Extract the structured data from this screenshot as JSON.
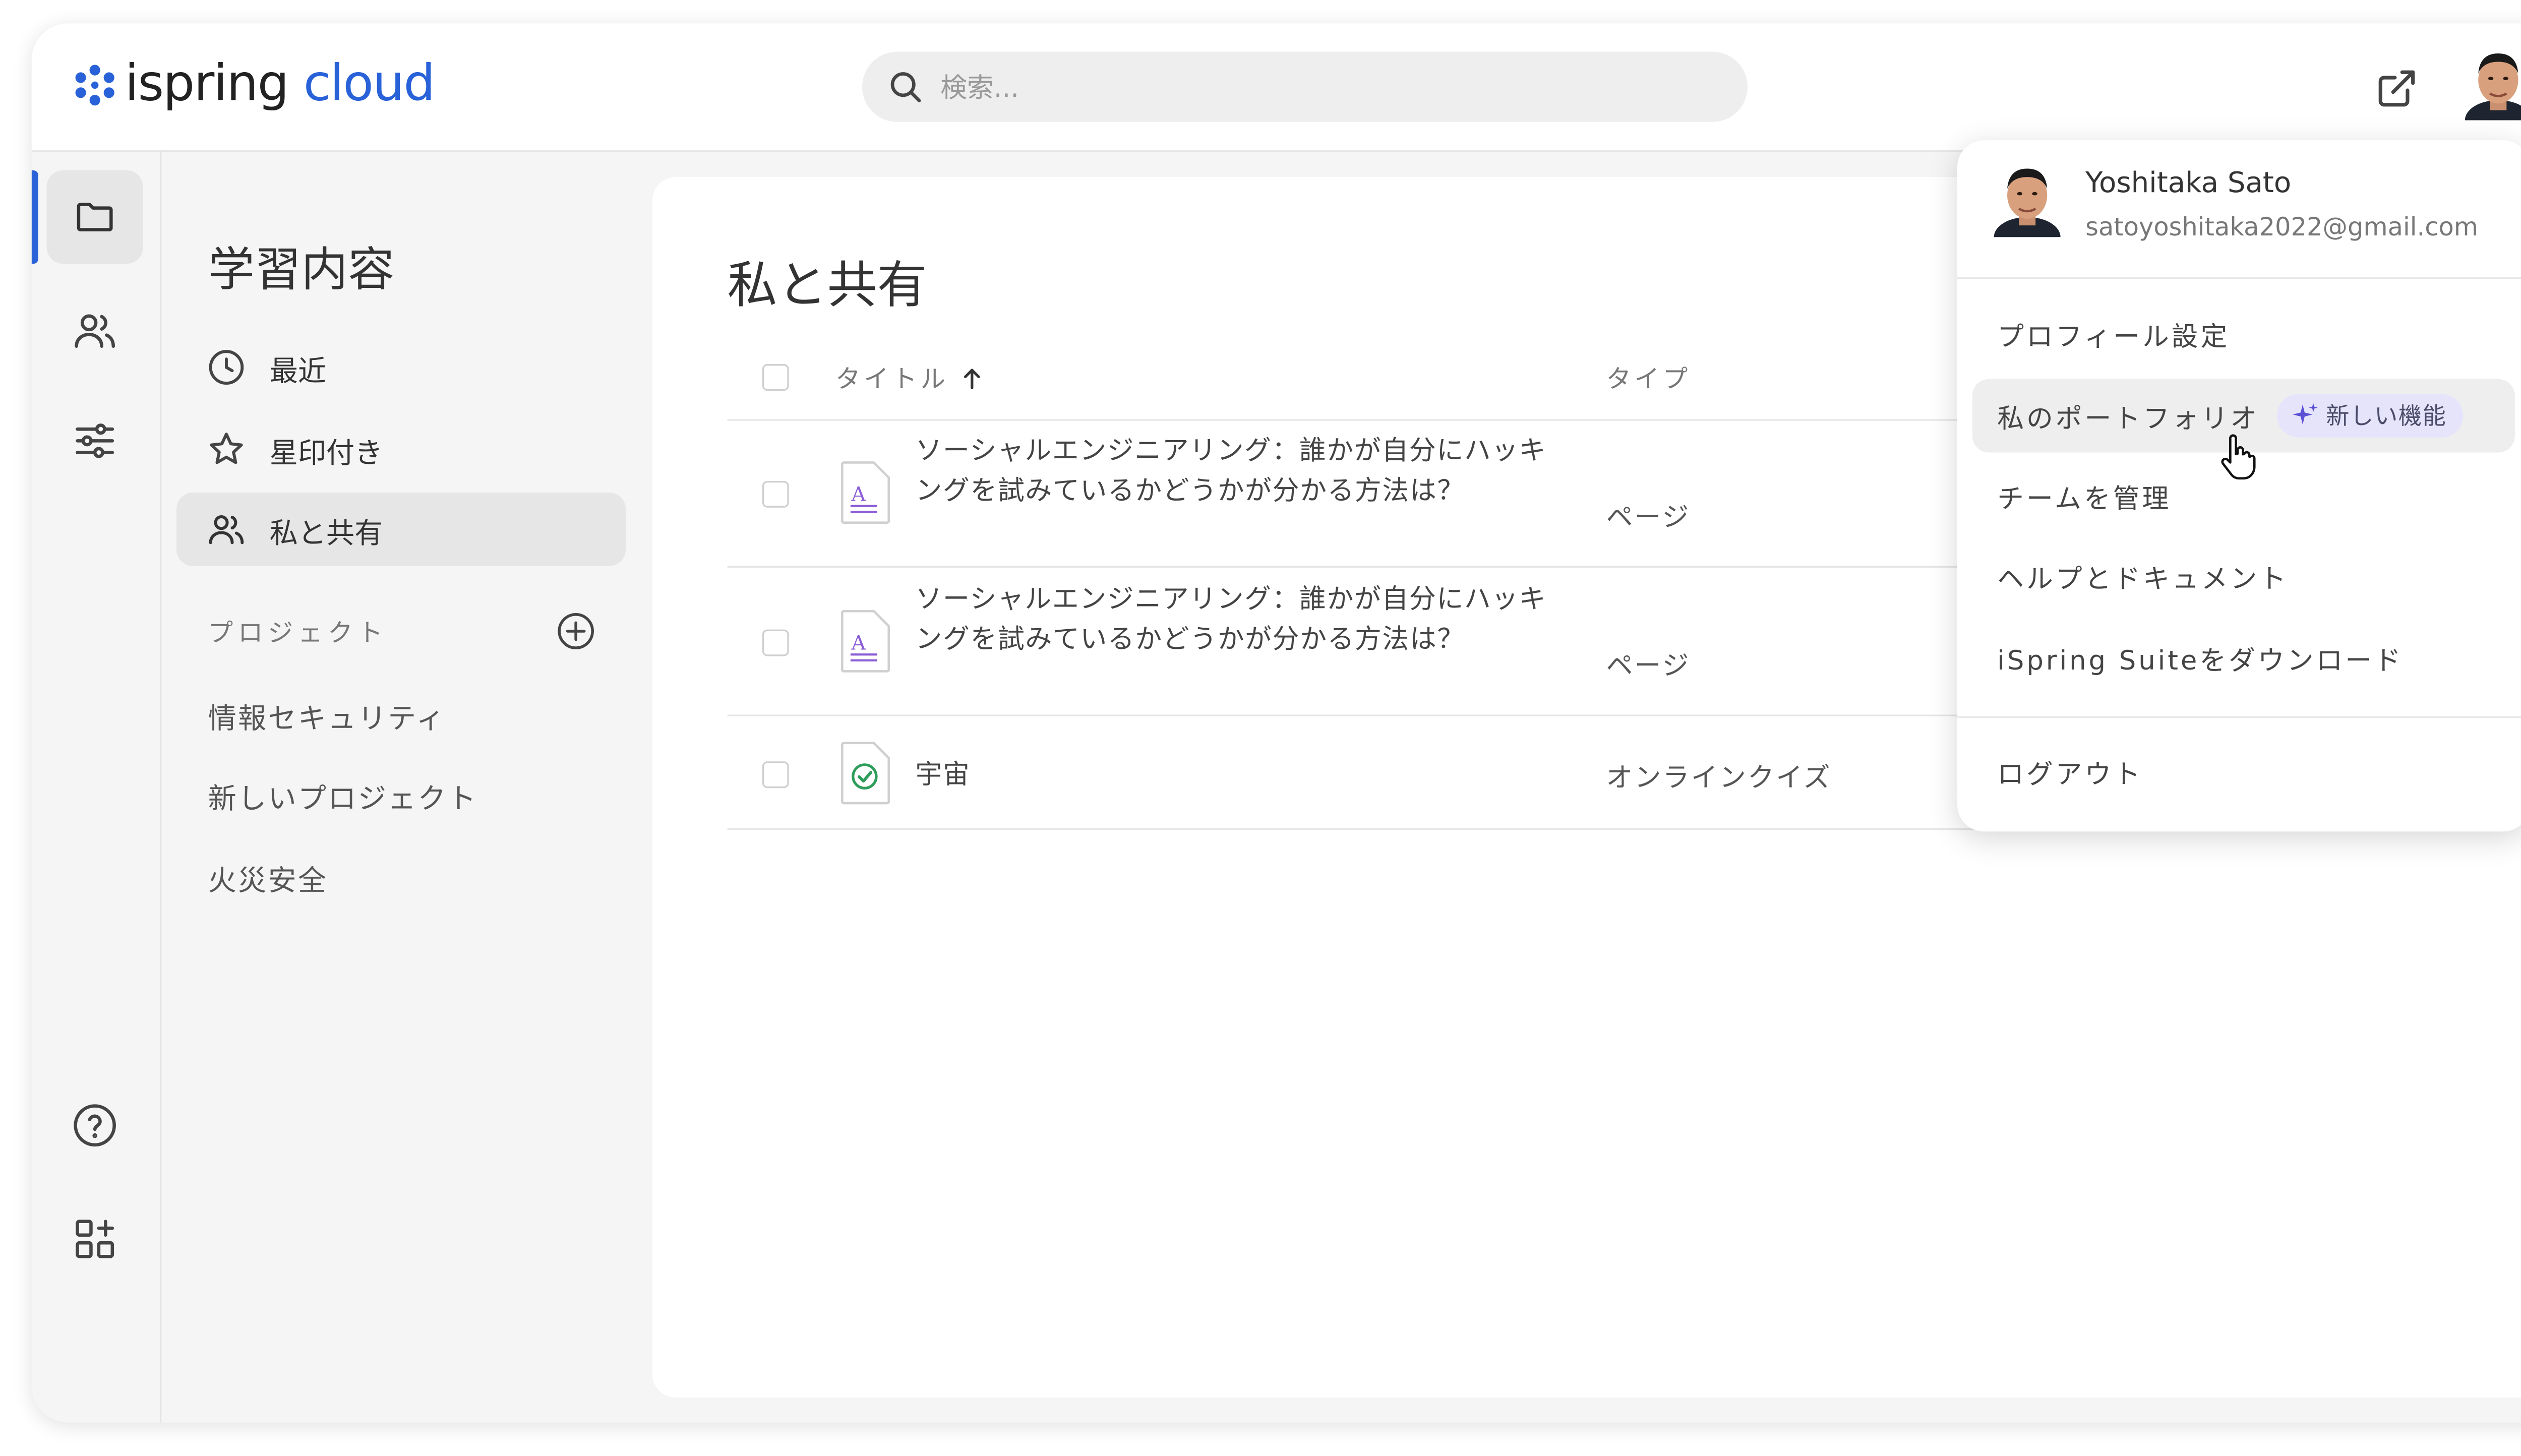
{
  "app": {
    "logo_word1": "ispring",
    "logo_word2": "cloud"
  },
  "search": {
    "placeholder": "検索..."
  },
  "nav": {
    "title": "学習内容",
    "items": [
      {
        "label": "最近",
        "icon": "clock-icon"
      },
      {
        "label": "星印付き",
        "icon": "star-icon"
      },
      {
        "label": "私と共有",
        "icon": "users-icon"
      }
    ],
    "projects_label": "プロジェクト",
    "projects": [
      "情報セキュリティ",
      "新しいプロジェクト",
      "火災安全"
    ]
  },
  "main": {
    "title": "私と共有",
    "columns": {
      "title": "タイトル",
      "type": "タイプ"
    },
    "rows": [
      {
        "title": "ソーシャルエンジニアリング：誰かが自分にハッキングを試みているかどうかが分かる方法は？",
        "type": "ページ",
        "icon": "page-file-icon"
      },
      {
        "title": "ソーシャルエンジニアリング：誰かが自分にハッキングを試みているかどうかが分かる方法は？",
        "type": "ページ",
        "icon": "page-file-icon"
      },
      {
        "title": "宇宙",
        "type": "オンラインクイズ",
        "icon": "quiz-file-icon"
      }
    ]
  },
  "account_menu": {
    "name": "Yoshitaka Sato",
    "email": "satoyoshitaka2022@gmail.com",
    "items": [
      {
        "label": "プロフィール設定"
      },
      {
        "label": "私のポートフォリオ",
        "badge": "新しい機能"
      },
      {
        "label": "チームを管理"
      },
      {
        "label": "ヘルプとドキュメント"
      },
      {
        "label": "iSpring Suiteをダウンロード"
      }
    ],
    "logout": "ログアウト"
  },
  "colors": {
    "accent": "#2962d8",
    "badge_bg": "#e6e4fb",
    "quiz_check": "#2e9d5b",
    "page_icon": "#8a5cd6"
  }
}
